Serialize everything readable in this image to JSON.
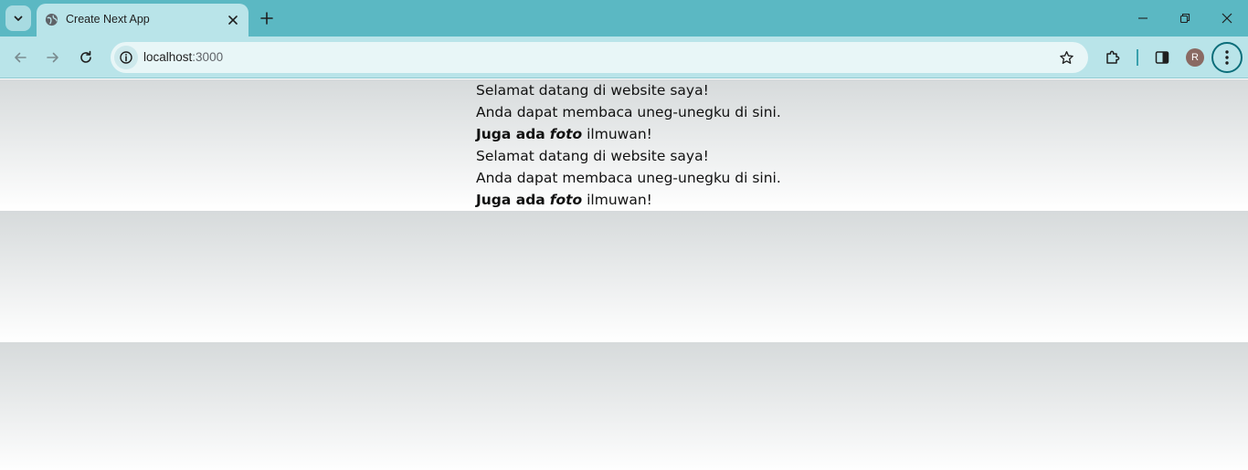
{
  "browser": {
    "tab": {
      "title": "Create Next App"
    },
    "address": {
      "host": "localhost",
      "port": ":3000"
    },
    "profile_initial": "R"
  },
  "page": {
    "blocks": [
      {
        "greeting": "Selamat datang di website saya!",
        "subtitle": "Anda dapat membaca uneg-unegku di sini.",
        "extra_prefix": "Juga ada",
        "extra_emphasis": "foto",
        "extra_suffix": "ilmuwan!"
      },
      {
        "greeting": "Selamat datang di website saya!",
        "subtitle": "Anda dapat membaca uneg-unegku di sini.",
        "extra_prefix": "Juga ada",
        "extra_emphasis": "foto",
        "extra_suffix": "ilmuwan!"
      }
    ]
  },
  "colors": {
    "tabstrip": "#5bb8c3",
    "toolbar": "#b9e4e9",
    "omnibox": "#e8f6f7",
    "page_gradient_top": "#d6dadb",
    "page_gradient_bottom": "#ffffff"
  }
}
